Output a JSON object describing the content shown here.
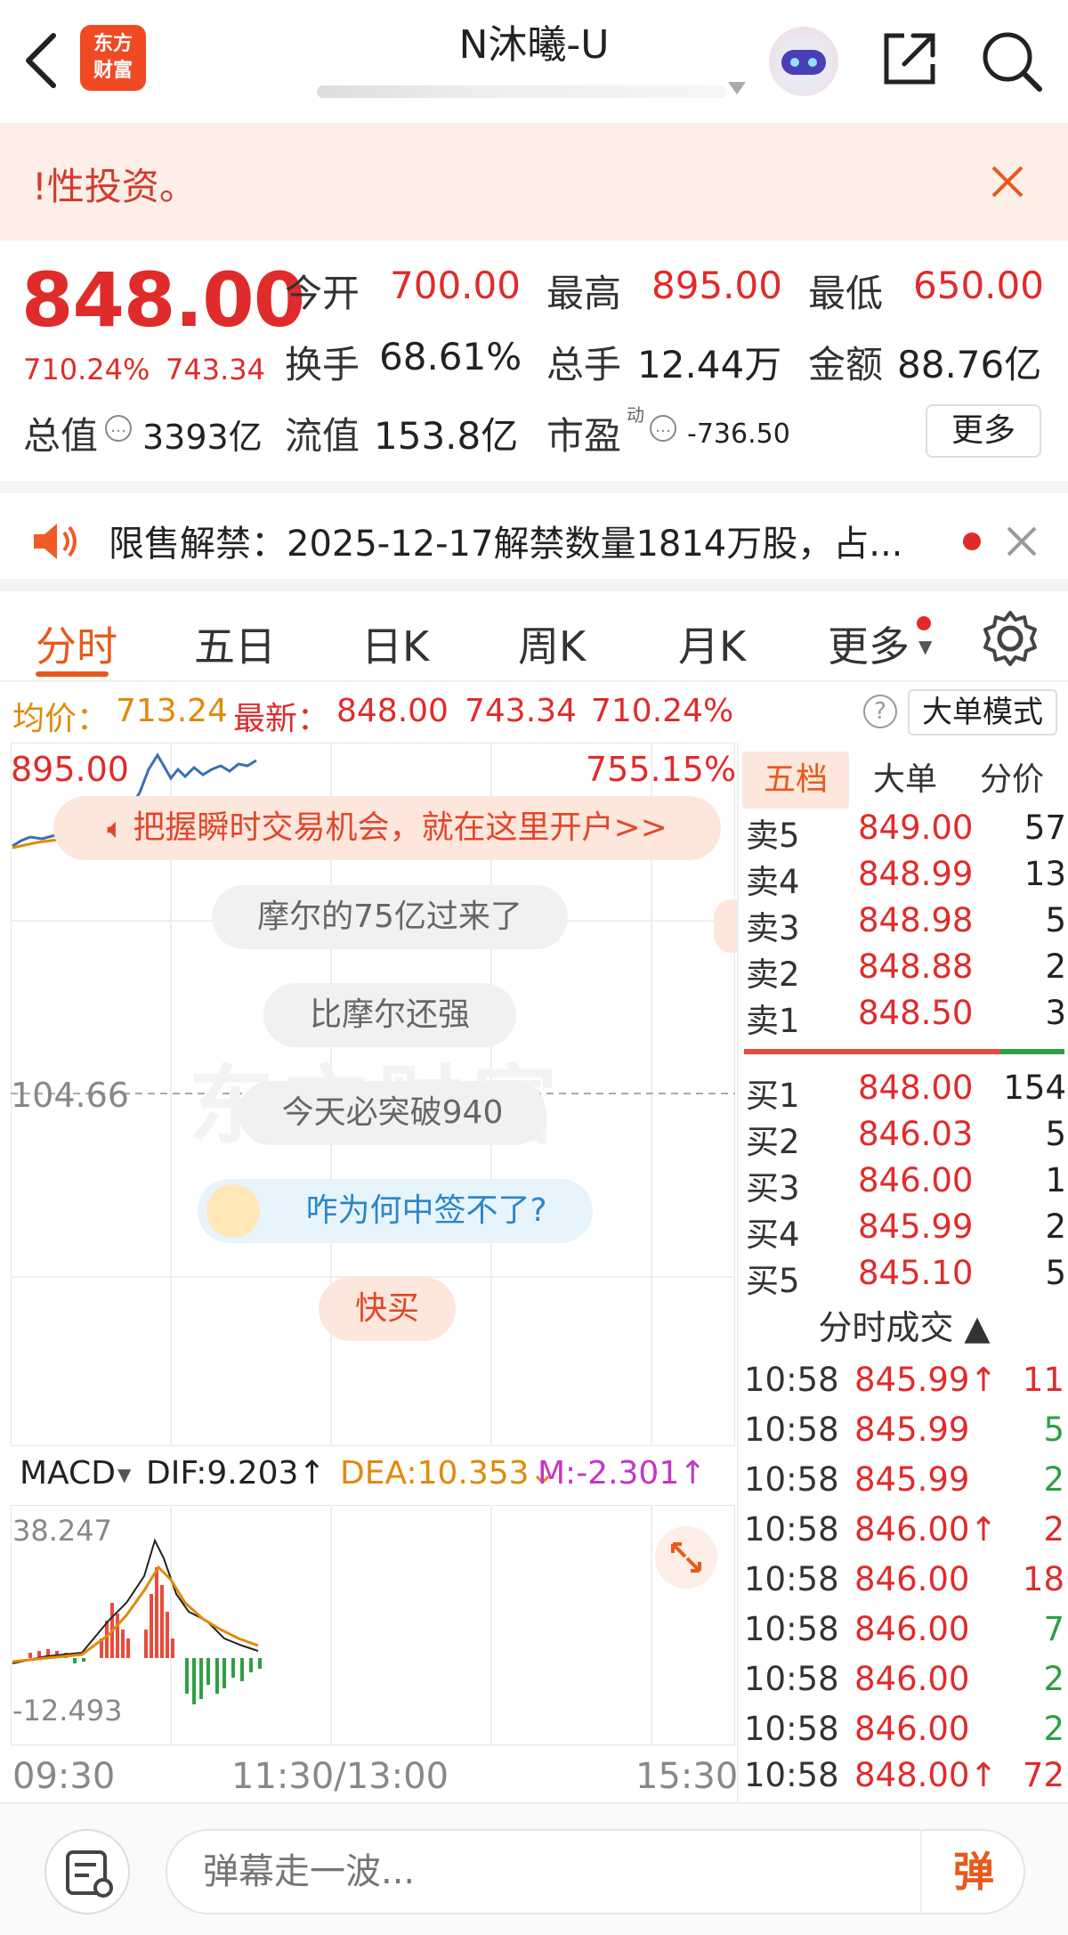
{
  "header": {
    "logo_text_line1": "东方",
    "logo_text_line2": "财富",
    "stock_name": "N沐曦-U",
    "icons": [
      "back-arrow-icon",
      "robot-assistant-icon",
      "share-icon",
      "search-icon"
    ]
  },
  "risk_banner": {
    "text": "!性投资。"
  },
  "quote": {
    "price": "848.00",
    "change_pct": "710.24%",
    "change_amt": "743.34",
    "open_label": "今开",
    "open": "700.00",
    "high_label": "最高",
    "high": "895.00",
    "low_label": "最低",
    "low": "650.00",
    "turnover_label": "换手",
    "turnover": "68.61%",
    "volume_label": "总手",
    "volume": "12.44万",
    "amount_label": "金额",
    "amount": "88.76亿",
    "mktcap_label": "总值",
    "mktcap": "3393亿",
    "float_label": "流值",
    "float": "153.8亿",
    "pe_label": "市盈",
    "pe_sup": "动",
    "pe": "-736.50",
    "more_label": "更多"
  },
  "notice": {
    "text": "限售解禁：2025-12-17解禁数量1814万股，占..."
  },
  "tabs": [
    {
      "label": "分时",
      "active": true
    },
    {
      "label": "五日"
    },
    {
      "label": "日K"
    },
    {
      "label": "周K"
    },
    {
      "label": "月K"
    },
    {
      "label": "更多"
    }
  ],
  "infoline": {
    "avg_label": "均价：",
    "avg": "713.24",
    "latest_label": "最新：",
    "latest": "848.00",
    "chg": "743.34",
    "pct": "710.24%",
    "help": "?",
    "big_mode": "大单模式"
  },
  "chart": {
    "y_top": "895.00",
    "pct_top": "755.15%",
    "y_mid": "104.66",
    "ad_text": "把握瞬时交易机会，就在这里开户>>",
    "danmaku": [
      "摩尔的75亿过来了",
      "比摩尔还强",
      "今天必突破940",
      "咋为何中签不了?",
      "快买"
    ],
    "watermark": "东方财富"
  },
  "macd": {
    "selector": "MACD",
    "dif": "DIF:9.203↑",
    "dea": "DEA:10.353↓",
    "m": "M:-2.301↑",
    "y_top": "38.247",
    "y_bottom": "-12.493"
  },
  "time_axis": {
    "start": "09:30",
    "mid": "11:30/13:00",
    "end": "15:30"
  },
  "order_book": {
    "tabs": [
      "五档",
      "大单",
      "分价"
    ],
    "asks": [
      {
        "label": "卖5",
        "price": "849.00",
        "vol": "57"
      },
      {
        "label": "卖4",
        "price": "848.99",
        "vol": "13"
      },
      {
        "label": "卖3",
        "price": "848.98",
        "vol": "5"
      },
      {
        "label": "卖2",
        "price": "848.88",
        "vol": "2"
      },
      {
        "label": "卖1",
        "price": "848.50",
        "vol": "3"
      }
    ],
    "bids": [
      {
        "label": "买1",
        "price": "848.00",
        "vol": "154"
      },
      {
        "label": "买2",
        "price": "846.03",
        "vol": "5"
      },
      {
        "label": "买3",
        "price": "846.00",
        "vol": "1"
      },
      {
        "label": "买4",
        "price": "845.99",
        "vol": "2"
      },
      {
        "label": "买5",
        "price": "845.10",
        "vol": "5"
      }
    ]
  },
  "trades": {
    "title": "分时成交 ▲",
    "rows": [
      {
        "time": "10:58",
        "price": "845.99↑",
        "vol": "11",
        "color": "red"
      },
      {
        "time": "10:58",
        "price": "845.99",
        "vol": "5",
        "color": "green"
      },
      {
        "time": "10:58",
        "price": "845.99",
        "vol": "2",
        "color": "green"
      },
      {
        "time": "10:58",
        "price": "846.00↑",
        "vol": "2",
        "color": "red"
      },
      {
        "time": "10:58",
        "price": "846.00",
        "vol": "18",
        "color": "red"
      },
      {
        "time": "10:58",
        "price": "846.00",
        "vol": "7",
        "color": "green"
      },
      {
        "time": "10:58",
        "price": "846.00",
        "vol": "2",
        "color": "green"
      },
      {
        "time": "10:58",
        "price": "846.00",
        "vol": "2",
        "color": "green"
      },
      {
        "time": "10:58",
        "price": "848.00↑",
        "vol": "72",
        "color": "red"
      }
    ]
  },
  "bottom": {
    "input_placeholder": "弹幕走一波...",
    "danmu_btn": "弹"
  },
  "colors": {
    "up": "#e02b2b",
    "down": "#2ea043",
    "accent": "#e8591a",
    "avg": "#e08a0b"
  }
}
